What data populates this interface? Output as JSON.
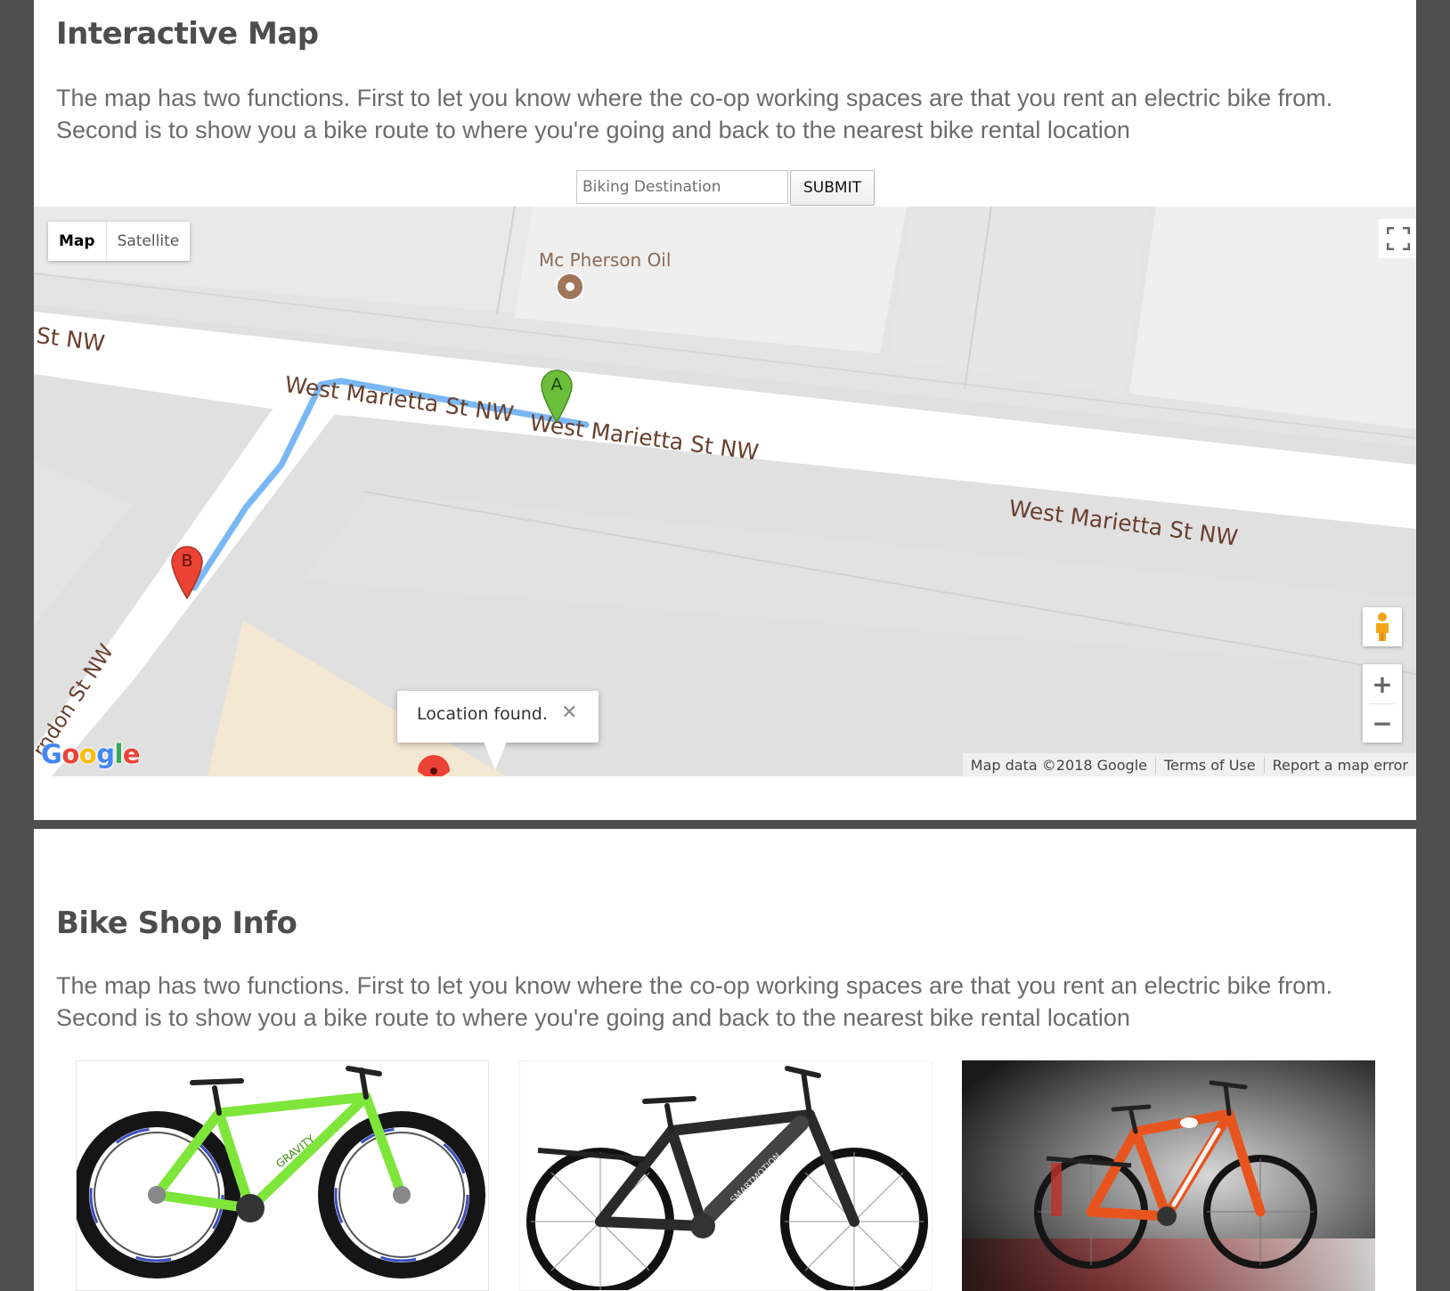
{
  "map_section": {
    "title": "Interactive Map",
    "description": "The map has two functions. First to let you know where the co-op working spaces are that you rent an electric bike from. Second is to show you a bike route to where you're going and back to the nearest bike rental location",
    "destination_placeholder": "Biking Destination",
    "destination_value": "",
    "submit_label": "SUBMIT"
  },
  "map": {
    "map_type_buttons": [
      "Map",
      "Satellite"
    ],
    "active_map_type": "Map",
    "poi_label": "Mc Pherson Oil",
    "street_labels": [
      "St NW",
      "West Marietta St NW",
      "West Marietta St NW",
      "West Marietta St NW",
      "rndon St NW"
    ],
    "markers": [
      "A",
      "B"
    ],
    "info_window_text": "Location found.",
    "google_logo": [
      "G",
      "o",
      "o",
      "g",
      "l",
      "e"
    ],
    "attribution": {
      "map_data": "Map data ©2018 Google",
      "terms": "Terms of Use",
      "report": "Report a map error"
    },
    "controls": {
      "fullscreen_icon": "fullscreen-icon",
      "pegman_icon": "pegman-icon",
      "zoom_in": "+",
      "zoom_out": "−"
    },
    "colors": {
      "route": "#7ab8f5",
      "marker_a": "#6bbf3a",
      "marker_b": "#ea4335",
      "poi": "#a0755a",
      "street_label": "#6a3f2e"
    }
  },
  "shop_section": {
    "title": "Bike Shop Info",
    "description": "The map has two functions. First to let you know where the co-op working spaces are that you rent an electric bike from. Second is to show you a bike route to where you're going and back to the nearest bike rental location",
    "bikes": [
      {
        "image": "green fat-tire bike",
        "frame_color": "#7ee63a",
        "frame_label": "GRAVITY"
      },
      {
        "image": "black electric bike",
        "frame_color": "#2a2a2a",
        "frame_label": "SMARTMOTION"
      },
      {
        "image": "orange electric bike",
        "frame_color": "#e8541e"
      }
    ]
  }
}
